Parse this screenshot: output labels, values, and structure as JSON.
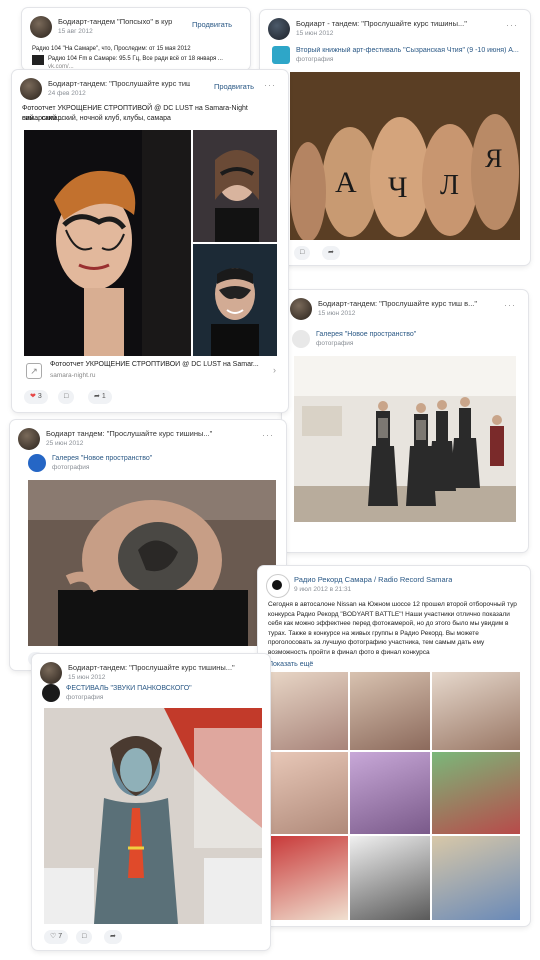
{
  "card1": {
    "author": "Бодиарт-тандем \"Попсыхо\" в курс тишины...",
    "date": "15 авг 2012",
    "promote": "Продвигать",
    "text_line1": "Радио 104 \"На Самаре\", что, Проследим: от 15 мая 2012",
    "text_line2": "Радио 104 Fm в Самаре: 95.5 Гц, Все ради всё от 18 января ...",
    "text_line3": "vk.com/..."
  },
  "card2": {
    "author": "Бодиарт - тандем: \"Прослушайте курс тишины...\"",
    "date": "15 июн 2012",
    "repost_name": "Вторый книжный арт-фестиваль \"Сызранская Чтия\" (9 -10 июня) А...",
    "repost_sub": "фотография",
    "likes": "",
    "share": ""
  },
  "card3": {
    "author": "Бодиарт-тандем: \"Прослушайте курс тиш...\"",
    "date": "24 фев 2012",
    "promote": "Продвигать",
    "text": "Фотоотчет УКРОЩЕНИЕ СТРОПТИВОЙ @ DC LUST на Samara-Night самарский...",
    "text2": "ний... самарский, ночной клуб, клубы, самара",
    "link_title": "Фотоотчет УКРОЩЕНИЕ СТРОПТИВОЙ @ DC LUST на Samar...",
    "link_url": "samara-night.ru",
    "likes": "3",
    "reposts": "1"
  },
  "card4": {
    "author": "Бодиарт-тандем: \"Прослушайте курс тиш в...\"",
    "date": "15 июн 2012",
    "repost_name": "Галерея \"Новое пространство\"",
    "repost_sub": "фотография"
  },
  "card5": {
    "author": "Бодиарт тандем: \"Прослушайте курс тишины...\"",
    "date": "25 июн 2012",
    "repost_name": "Галерея \"Новое пространство\"",
    "repost_sub": "фотография"
  },
  "card6": {
    "author": "Радио Рекорд Самара / Radio Record Samara",
    "date": "9 июл 2012 в 21:31",
    "text": "Сегодня в автосалоне Nissan на Южном шоссе 12 прошел второй отборочный тур конкурса Радио Рекорд \"BODYART BATTLE\"! Наши участники отлично показали себя как можно эффектнее перед фотокамерой, но до этого было мы увидим в турах. Также в конкурсе на живых группы в Радио Рекорд. Вы можете проголосовать за лучшую фотографию участника, тем самым дать ему возможность пройти в финал фото в финал конкурса",
    "show_more": "Показать ещё"
  },
  "card7": {
    "author": "Бодиарт-тандем: \"Прослушайте курс тишины...\"",
    "date": "15 июн 2012",
    "repost_name": "ФЕСТИВАЛЬ \"ЗВУКИ ПАНКОВСКОГО\"",
    "repost_sub": "фотография",
    "likes": "7"
  },
  "colors": {
    "link": "#2a5885",
    "like_red": "#e64646",
    "border": "#e3e4e8"
  }
}
